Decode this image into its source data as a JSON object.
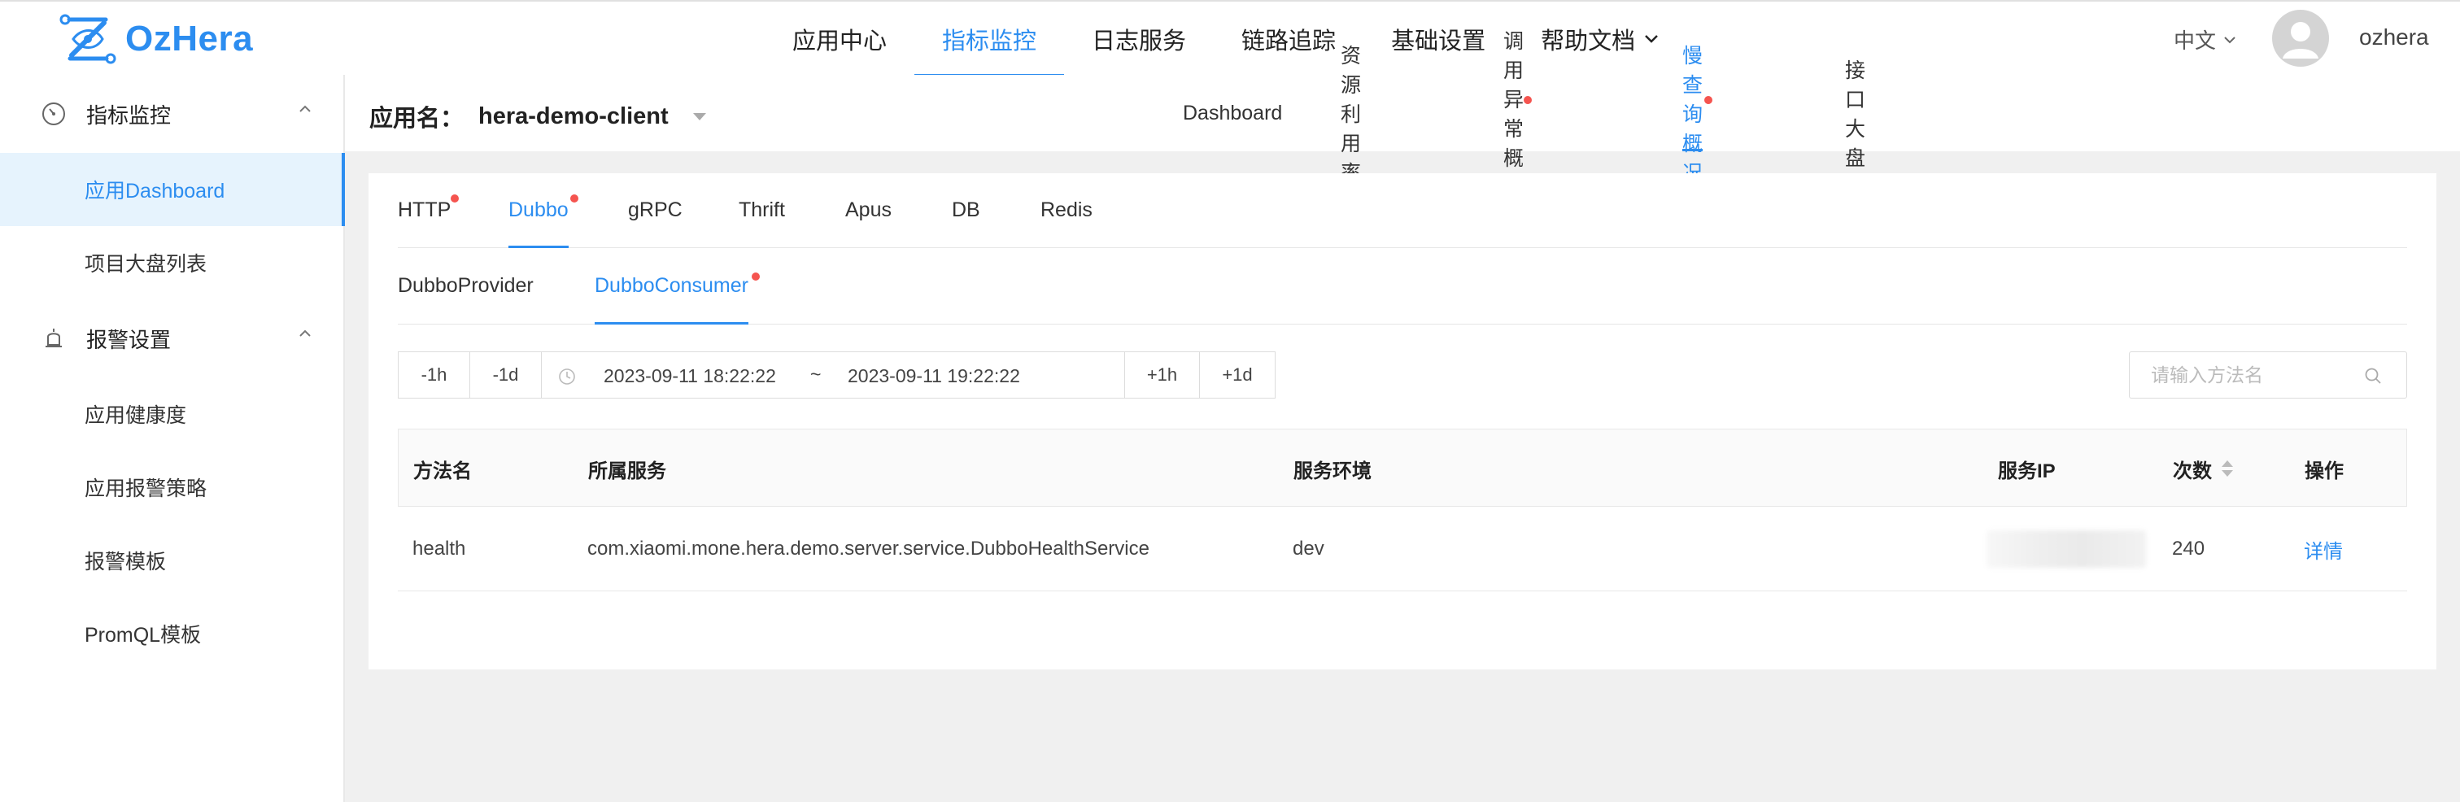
{
  "brand": {
    "name": "OzHera"
  },
  "topnav": {
    "items": [
      {
        "label": "应用中心"
      },
      {
        "label": "指标监控"
      },
      {
        "label": "日志服务"
      },
      {
        "label": "链路追踪"
      },
      {
        "label": "基础设置"
      },
      {
        "label": "帮助文档"
      }
    ],
    "active": "指标监控",
    "language": "中文",
    "username": "ozhera"
  },
  "sidebar": {
    "groups": [
      {
        "label": "指标监控",
        "icon": "speedometer-icon",
        "items": [
          "应用Dashboard",
          "项目大盘列表"
        ]
      },
      {
        "label": "报警设置",
        "icon": "alarm-bell-icon",
        "items": [
          "应用健康度",
          "应用报警策略",
          "报警模板",
          "PromQL模板"
        ]
      }
    ],
    "active_item": "应用Dashboard"
  },
  "app_header": {
    "app_label": "应用名：",
    "app_name": "hera-demo-client",
    "tabs": [
      "Dashboard",
      "资源利用率",
      "调用异常概况",
      "慢查询概况",
      "接口大盘"
    ],
    "active_tab": "慢查询概况"
  },
  "protocol_tabs": [
    "HTTP",
    "Dubbo",
    "gRPC",
    "Thrift",
    "Apus",
    "DB",
    "Redis"
  ],
  "active_protocol": "Dubbo",
  "dubbo_tabs": [
    "DubboProvider",
    "DubboConsumer"
  ],
  "active_dubbo_tab": "DubboConsumer",
  "time_range": {
    "buttons_before": [
      "-1h",
      "-1d"
    ],
    "start": "2023-09-11 18:22:22",
    "separator": "~",
    "end": "2023-09-11 19:22:22",
    "buttons_after": [
      "+1h",
      "+1d"
    ]
  },
  "search": {
    "placeholder": "请输入方法名"
  },
  "table": {
    "columns": [
      "方法名",
      "所属服务",
      "服务环境",
      "服务IP",
      "次数",
      "操作"
    ],
    "rows": [
      {
        "method": "health",
        "service": "com.xiaomi.mone.hera.demo.server.service.DubboHealthService",
        "env": "dev",
        "ip": "",
        "count": "240",
        "action": "详情"
      }
    ]
  },
  "colors": {
    "accent": "#2c8df0",
    "badge_dot": "#f5544f",
    "active_bg": "#e6f3fd"
  }
}
